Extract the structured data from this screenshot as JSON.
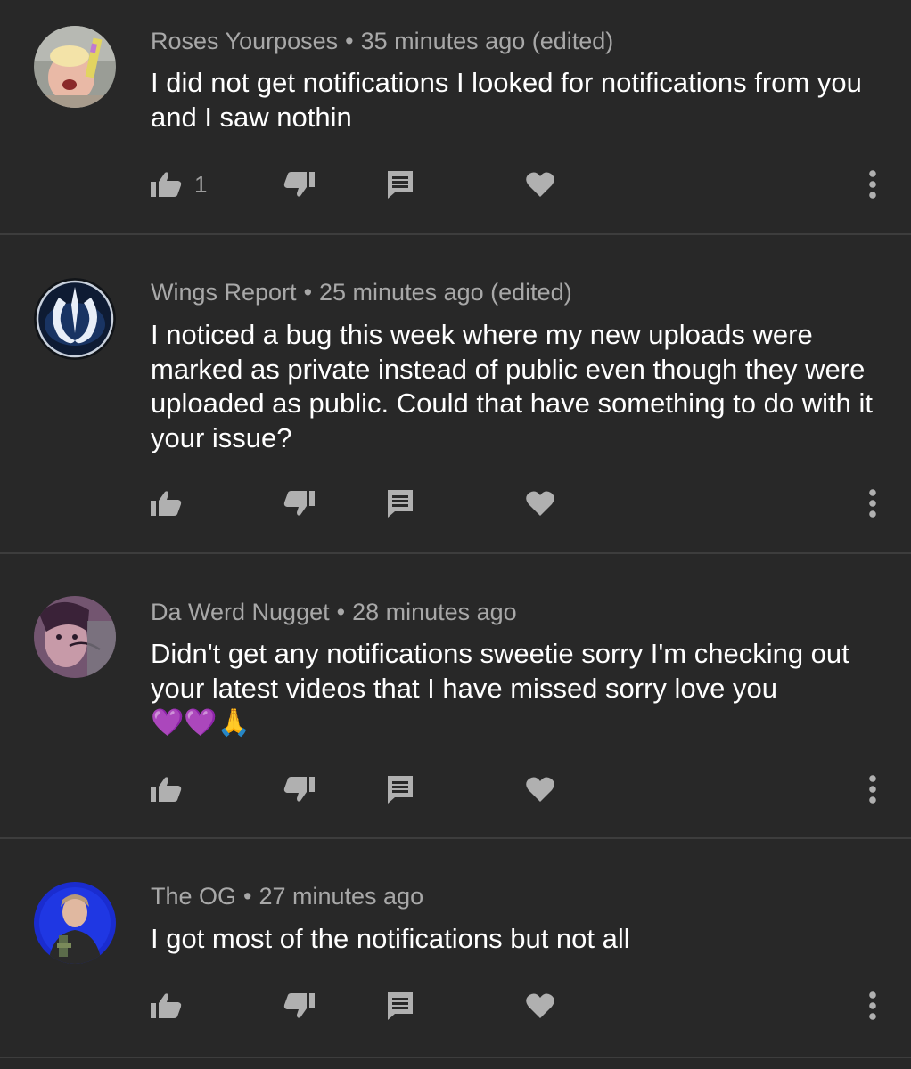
{
  "comments": [
    {
      "author": "Roses Yourposes",
      "time": "35 minutes ago (edited)",
      "text": "I did not get notifications I looked for notifications from you and I saw nothin",
      "likes": "1",
      "avatar_icon": "user-photo-avatar"
    },
    {
      "author": "Wings Report",
      "time": "25 minutes ago (edited)",
      "text": "I noticed a bug this week where my new uploads were marked as private instead of public even though they were uploaded as public. Could that have something to do with it your issue?",
      "likes": "",
      "avatar_icon": "rebel-alliance-avatar"
    },
    {
      "author": "Da Werd Nugget",
      "time": "28 minutes ago",
      "text": "Didn't get any notifications sweetie sorry I'm checking out your latest videos that I have missed sorry love you",
      "emojis": [
        "💜",
        "💜",
        "🙏"
      ],
      "likes": "",
      "avatar_icon": "user-photo-avatar"
    },
    {
      "author": "The OG",
      "time": "27 minutes ago",
      "text": "I got most of the notifications but not all",
      "likes": "",
      "avatar_icon": "user-photo-avatar"
    }
  ],
  "separator": "•",
  "colors": {
    "background": "#282828",
    "divider": "#3d3d3d",
    "meta_text": "#a8a8a8",
    "body_text": "#ffffff",
    "icon": "#b0b0b0"
  }
}
